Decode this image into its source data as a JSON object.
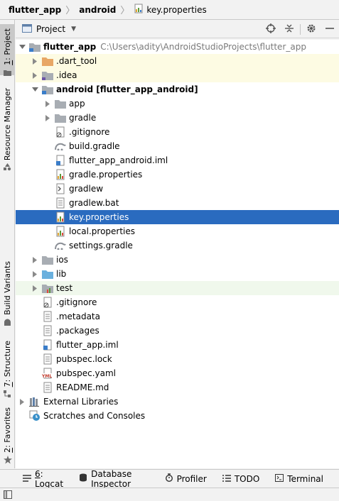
{
  "breadcrumb": [
    {
      "label": "flutter_app"
    },
    {
      "label": "android"
    },
    {
      "label": "key.properties"
    }
  ],
  "left_strip": {
    "tabs": [
      {
        "label": "1: Project",
        "active": true
      },
      {
        "label": "Resource Manager",
        "active": false
      },
      {
        "label": "Build Variants",
        "active": false
      },
      {
        "label": "7: Structure",
        "active": false
      },
      {
        "label": "2: Favorites",
        "active": false
      }
    ]
  },
  "panel": {
    "title": "Project",
    "actions": [
      "target-icon",
      "collapse-all-icon",
      "gear-icon",
      "minimize-icon"
    ]
  },
  "tree": {
    "rows": [
      {
        "label": "flutter_app",
        "path": "C:\\Users\\adity\\AndroidStudioProjects\\flutter_app",
        "icon": "module-folder",
        "expanded": true,
        "level": 0
      },
      {
        "label": ".dart_tool",
        "icon": "folder-orange",
        "expanded": false,
        "level": 1,
        "bg": "excluded"
      },
      {
        "label": ".idea",
        "icon": "folder-idea",
        "expanded": false,
        "level": 1,
        "bg": "excluded"
      },
      {
        "label": "android [flutter_app_android]",
        "icon": "module-folder",
        "expanded": true,
        "level": 1
      },
      {
        "label": "app",
        "icon": "folder",
        "expanded": false,
        "level": 2
      },
      {
        "label": "gradle",
        "icon": "folder",
        "expanded": false,
        "level": 2
      },
      {
        "label": ".gitignore",
        "icon": "gitignore",
        "level": 2
      },
      {
        "label": "build.gradle",
        "icon": "gradle",
        "level": 2
      },
      {
        "label": "flutter_app_android.iml",
        "icon": "iml",
        "level": 2
      },
      {
        "label": "gradle.properties",
        "icon": "properties",
        "level": 2
      },
      {
        "label": "gradlew",
        "icon": "script",
        "level": 2
      },
      {
        "label": "gradlew.bat",
        "icon": "file",
        "level": 2
      },
      {
        "label": "key.properties",
        "icon": "properties",
        "level": 2,
        "selected": true
      },
      {
        "label": "local.properties",
        "icon": "properties",
        "level": 2
      },
      {
        "label": "settings.gradle",
        "icon": "gradle",
        "level": 2
      },
      {
        "label": "ios",
        "icon": "folder",
        "expanded": false,
        "level": 1
      },
      {
        "label": "lib",
        "icon": "folder-blue",
        "expanded": false,
        "level": 1
      },
      {
        "label": "test",
        "icon": "folder-test",
        "expanded": false,
        "level": 1,
        "bg": "test"
      },
      {
        "label": ".gitignore",
        "icon": "gitignore",
        "level": 1
      },
      {
        "label": ".metadata",
        "icon": "file",
        "level": 1
      },
      {
        "label": ".packages",
        "icon": "file",
        "level": 1
      },
      {
        "label": "flutter_app.iml",
        "icon": "iml",
        "level": 1
      },
      {
        "label": "pubspec.lock",
        "icon": "file",
        "level": 1
      },
      {
        "label": "pubspec.yaml",
        "icon": "yaml",
        "level": 1
      },
      {
        "label": "README.md",
        "icon": "file",
        "level": 1
      },
      {
        "label": "External Libraries",
        "icon": "libraries",
        "expanded": false,
        "level": 0
      },
      {
        "label": "Scratches and Consoles",
        "icon": "scratches",
        "level": 0
      }
    ]
  },
  "bottom_bar": {
    "tabs": [
      {
        "label": "6: Logcat",
        "icon": "logcat-icon"
      },
      {
        "label": "Database Inspector",
        "icon": "database-icon"
      },
      {
        "label": "Profiler",
        "icon": "profiler-icon"
      },
      {
        "label": "TODO",
        "icon": "todo-icon"
      },
      {
        "label": "Terminal",
        "icon": "terminal-icon"
      }
    ]
  },
  "colors": {
    "selection": "#2a6bbf",
    "excluded_bg": "#fdfbe3",
    "test_bg": "#f0f8ec",
    "folder": "#a8adb3",
    "orange_folder": "#e8a765",
    "blue_folder": "#6ab0de"
  }
}
